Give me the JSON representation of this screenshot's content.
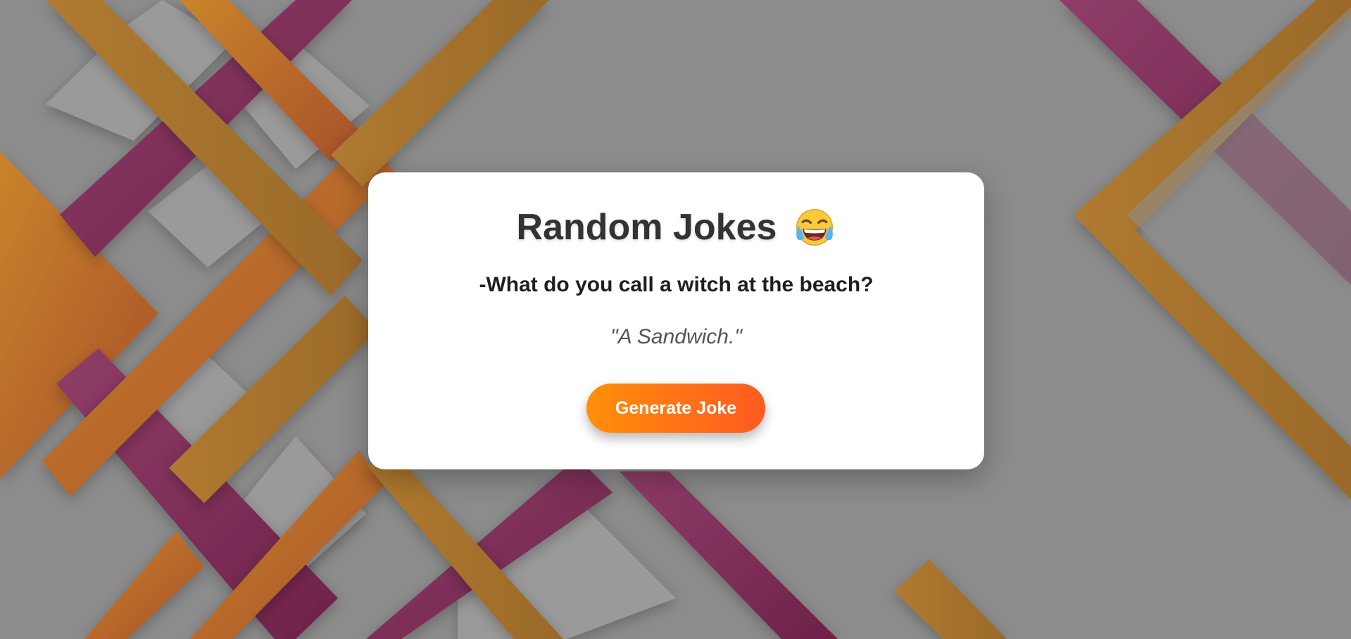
{
  "app": {
    "title": "Random Jokes",
    "title_icon": "tears-of-joy-emoji-icon"
  },
  "joke": {
    "question": "-What do you call a witch at the beach?",
    "answer": "\"A Sandwich.\""
  },
  "actions": {
    "generate_label": "Generate Joke"
  },
  "colors": {
    "background_gray": "#8a8a8a",
    "stripe_magenta": "#8b3560",
    "stripe_orange": "#c8702a",
    "stripe_gold": "#b98a30",
    "button_start": "#ff8f0a",
    "button_end": "#ff5a22",
    "title_text": "#333333"
  }
}
